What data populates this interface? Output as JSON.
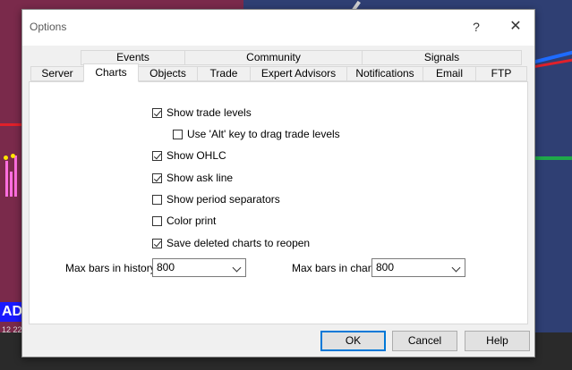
{
  "dialog": {
    "title": "Options",
    "help_glyph": "?",
    "close_glyph": "✕"
  },
  "tabs": {
    "row1": [
      "Events",
      "Community",
      "Signals"
    ],
    "row2": [
      "Server",
      "Charts",
      "Objects",
      "Trade",
      "Expert Advisors",
      "Notifications",
      "Email",
      "FTP"
    ],
    "selected": "Charts"
  },
  "charts": {
    "show_trade_levels": {
      "label": "Show trade levels",
      "checked": true
    },
    "alt_drag": {
      "label": "Use 'Alt' key to drag trade levels",
      "checked": false
    },
    "show_ohlc": {
      "label": "Show OHLC",
      "checked": true
    },
    "show_ask": {
      "label": "Show ask line",
      "checked": true
    },
    "period_sep": {
      "label": "Show period separators",
      "checked": false
    },
    "color_print": {
      "label": "Color print",
      "checked": false
    },
    "save_deleted": {
      "label": "Save deleted charts to reopen",
      "checked": true
    },
    "max_history_label": "Max bars in history:",
    "max_history_value": "800",
    "max_chart_label": "Max bars in chart:",
    "max_chart_value": "800"
  },
  "buttons": {
    "ok": "OK",
    "cancel": "Cancel",
    "help": "Help"
  },
  "background": {
    "ticker_text": "AD",
    "time_text": "12 22."
  },
  "colors": {
    "accent": "#0078d7",
    "bg_left": "#7a2a4b",
    "bg_right": "#2f3f73"
  }
}
